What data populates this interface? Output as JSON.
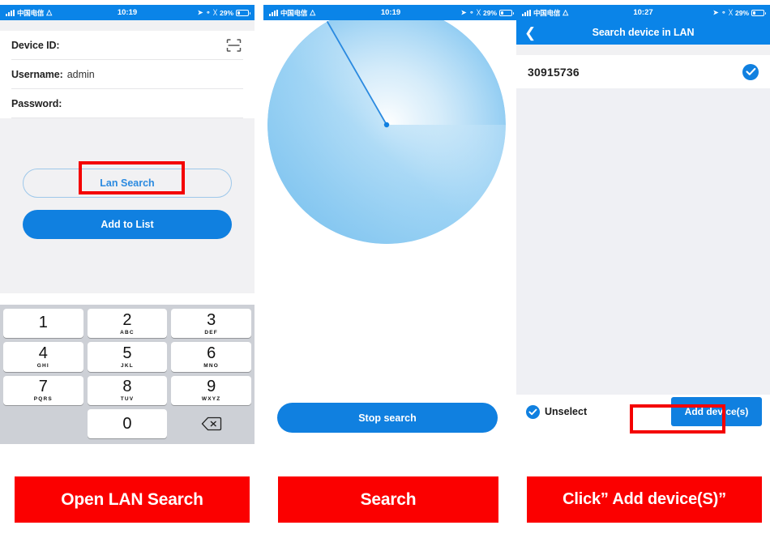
{
  "panels": [
    {
      "statusbar": {
        "carrier": "中国电信",
        "time": "10:19",
        "battery": "29%",
        "wifi_icon": "wifi-icon",
        "signal_icon": "signal-bars-icon",
        "location_icon": "location-arrow-icon",
        "lock_icon": "rotation-lock-icon",
        "bluetooth_icon": "bluetooth-icon"
      },
      "form": {
        "rows": [
          {
            "label": "Device ID:",
            "value": "",
            "icon": "qr-scan-icon"
          },
          {
            "label": "Username:",
            "value": "admin"
          },
          {
            "label": "Password:",
            "value": ""
          }
        ]
      },
      "buttons": {
        "lan_search": "Lan Search",
        "add_to_list": "Add to List"
      },
      "keypad": {
        "keys": [
          {
            "num": "1",
            "sub": ""
          },
          {
            "num": "2",
            "sub": "ABC"
          },
          {
            "num": "3",
            "sub": "DEF"
          },
          {
            "num": "4",
            "sub": "GHI"
          },
          {
            "num": "5",
            "sub": "JKL"
          },
          {
            "num": "6",
            "sub": "MNO"
          },
          {
            "num": "7",
            "sub": "PQRS"
          },
          {
            "num": "8",
            "sub": "TUV"
          },
          {
            "num": "9",
            "sub": "WXYZ"
          },
          {
            "num": "0",
            "sub": ""
          }
        ],
        "delete_icon": "backspace-icon"
      }
    },
    {
      "statusbar": {
        "carrier": "中国电信",
        "time": "10:19",
        "battery": "29%"
      },
      "radar": {
        "center_dot_color": "#1080e0",
        "sweep_line_color": "#2b8ae0",
        "sweep_fill_color": "#8ecbf2"
      },
      "buttons": {
        "stop_search": "Stop search"
      }
    },
    {
      "statusbar": {
        "carrier": "中国电信",
        "time": "10:27",
        "battery": "29%"
      },
      "navbar": {
        "back_icon": "chevron-left-icon",
        "title": "Search device in LAN"
      },
      "device_list": [
        {
          "id": "30915736",
          "selected": true,
          "check_icon": "check-circle-icon"
        }
      ],
      "bottom": {
        "unselect_label": "Unselect",
        "unselect_icon": "check-circle-icon",
        "add_button": "Add device(s)"
      }
    }
  ],
  "captions": [
    {
      "text": "Open LAN Search"
    },
    {
      "text": "Search"
    },
    {
      "text": "Click”  Add device(S)”"
    }
  ],
  "colors": {
    "accent_blue": "#1080e0",
    "nav_blue": "#0a84e8",
    "annotation_red": "#f40000",
    "caption_red": "#fb0000"
  }
}
